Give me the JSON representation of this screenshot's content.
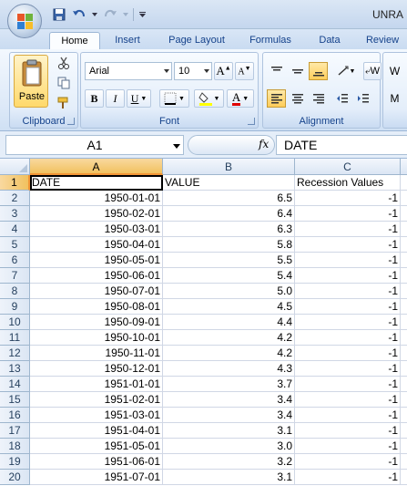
{
  "window": {
    "title": "UNRA"
  },
  "ribbon_tabs": [
    "Home",
    "Insert",
    "Page Layout",
    "Formulas",
    "Data",
    "Review"
  ],
  "clipboard": {
    "paste_label": "Paste",
    "group_label": "Clipboard"
  },
  "font": {
    "name": "Arial",
    "size": "10",
    "group_label": "Font"
  },
  "alignment": {
    "group_label": "Alignment",
    "wrap_partial": "W",
    "merge_partial": "M"
  },
  "formula_bar": {
    "name_box": "A1",
    "fx_label": "fx",
    "content": "DATE"
  },
  "columns": [
    "A",
    "B",
    "C"
  ],
  "sheet": {
    "row_numbers": [
      "1",
      "2",
      "3",
      "4",
      "5",
      "6",
      "7",
      "8",
      "9",
      "10",
      "11",
      "12",
      "13",
      "14",
      "15",
      "16",
      "17",
      "18",
      "19",
      "20"
    ],
    "headers": [
      "DATE",
      "VALUE",
      "Recession Values"
    ],
    "rows": [
      [
        "1950-01-01",
        "6.5",
        "-1"
      ],
      [
        "1950-02-01",
        "6.4",
        "-1"
      ],
      [
        "1950-03-01",
        "6.3",
        "-1"
      ],
      [
        "1950-04-01",
        "5.8",
        "-1"
      ],
      [
        "1950-05-01",
        "5.5",
        "-1"
      ],
      [
        "1950-06-01",
        "5.4",
        "-1"
      ],
      [
        "1950-07-01",
        "5.0",
        "-1"
      ],
      [
        "1950-08-01",
        "4.5",
        "-1"
      ],
      [
        "1950-09-01",
        "4.4",
        "-1"
      ],
      [
        "1950-10-01",
        "4.2",
        "-1"
      ],
      [
        "1950-11-01",
        "4.2",
        "-1"
      ],
      [
        "1950-12-01",
        "4.3",
        "-1"
      ],
      [
        "1951-01-01",
        "3.7",
        "-1"
      ],
      [
        "1951-02-01",
        "3.4",
        "-1"
      ],
      [
        "1951-03-01",
        "3.4",
        "-1"
      ],
      [
        "1951-04-01",
        "3.1",
        "-1"
      ],
      [
        "1951-05-01",
        "3.0",
        "-1"
      ],
      [
        "1951-06-01",
        "3.2",
        "-1"
      ],
      [
        "1951-07-01",
        "3.1",
        "-1"
      ]
    ]
  },
  "colors": {
    "selection_header": "#f1c15f",
    "ribbon_text": "#15428b",
    "gridline": "#d0d7e5"
  }
}
